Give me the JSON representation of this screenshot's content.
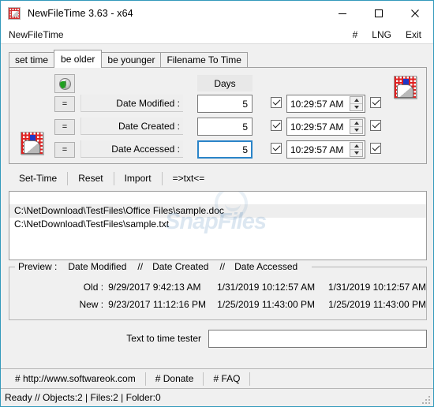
{
  "window": {
    "title": "NewFileTime 3.63 - x64",
    "icon": "checkered-clock-icon",
    "minimize": "minimize-icon",
    "maximize": "maximize-icon",
    "close": "close-icon"
  },
  "menu": {
    "app_name": "NewFileTime",
    "hash": "#",
    "language": "LNG",
    "exit": "Exit"
  },
  "tabs": [
    {
      "label": "set time",
      "active": false
    },
    {
      "label": "be older",
      "active": true
    },
    {
      "label": "be younger",
      "active": false
    },
    {
      "label": "Filename To Time",
      "active": false
    }
  ],
  "form": {
    "globe_button": "globe-refresh-icon",
    "days_header": "Days",
    "icon_top_right": "checkered-pointer-icon",
    "icon_bottom_left": "checkered-pointer-icon",
    "rows": [
      {
        "eq": "=",
        "label": "Date Modified :",
        "days": "5",
        "days_focused": false,
        "left_checked": true,
        "time": "10:29:57 AM",
        "right_checked": true
      },
      {
        "eq": "=",
        "label": "Date Created :",
        "days": "5",
        "days_focused": false,
        "left_checked": true,
        "time": "10:29:57 AM",
        "right_checked": true
      },
      {
        "eq": "=",
        "label": "Date Accessed :",
        "days": "5",
        "days_focused": true,
        "left_checked": true,
        "time": "10:29:57 AM",
        "right_checked": true
      }
    ]
  },
  "actions": [
    {
      "label": "Set-Time"
    },
    {
      "label": "Reset"
    },
    {
      "label": "Import"
    },
    {
      "label": "=>txt<="
    }
  ],
  "file_list": {
    "watermark": "SnapFiles",
    "items": [
      {
        "path": "C:\\NetDownload\\TestFiles\\Office Files\\sample.doc",
        "selected": true
      },
      {
        "path": "C:\\NetDownload\\TestFiles\\sample.txt",
        "selected": false
      }
    ]
  },
  "preview": {
    "legend_label": "Preview :",
    "legend_modified": "Date Modified",
    "legend_sep1": "//",
    "legend_created": "Date Created",
    "legend_sep2": "//",
    "legend_accessed": "Date Accessed",
    "old_label": "Old :",
    "old_modified": "9/29/2017 9:42:13 AM",
    "old_created": "1/31/2019 10:12:57 AM",
    "old_accessed": "1/31/2019 10:12:57 AM",
    "new_label": "New :",
    "new_modified": "9/23/2017 11:12:16 PM",
    "new_created": "1/25/2019 11:43:00 PM",
    "new_accessed": "1/25/2019 11:43:00 PM"
  },
  "tester": {
    "label": "Text to time tester",
    "value": "",
    "placeholder": ""
  },
  "links": [
    {
      "label": "# http://www.softwareok.com"
    },
    {
      "label": "# Donate"
    },
    {
      "label": "# FAQ"
    }
  ],
  "status": {
    "text": "Ready // Objects:2 | Files:2  | Folder:0",
    "grip": "resize-grip-icon"
  },
  "colors": {
    "window_border": "#3399bb",
    "face": "#f0f0f0",
    "focus": "#2a84c8",
    "icon_red": "#e02020"
  }
}
